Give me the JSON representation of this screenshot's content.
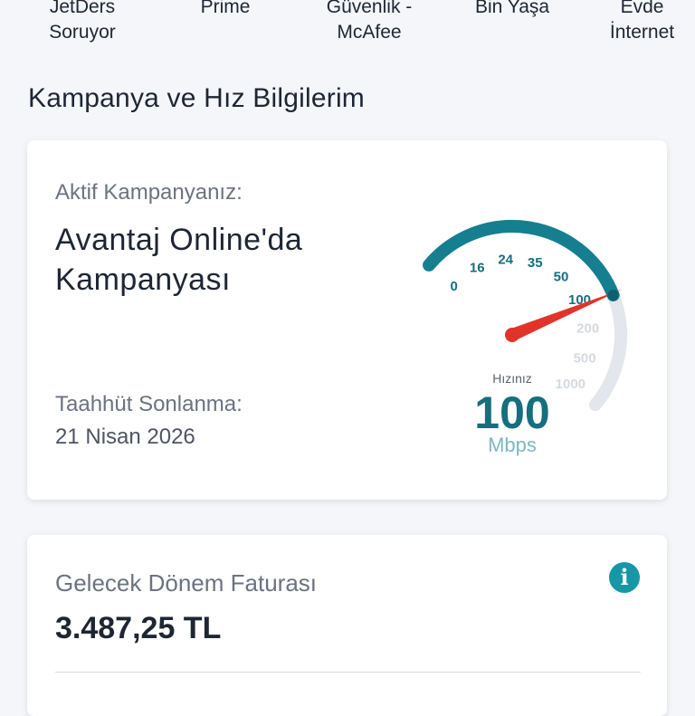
{
  "top_nav": {
    "items": [
      {
        "label_line1": "JetDers",
        "label_line2": "Soruyor"
      },
      {
        "label_line1": "Prime",
        "label_line2": ""
      },
      {
        "label_line1": "Güvenlik -",
        "label_line2": "McAfee"
      },
      {
        "label_line1": "Bin Yaşa",
        "label_line2": ""
      },
      {
        "label_line1": "Evde",
        "label_line2": "İnternet"
      }
    ]
  },
  "section": {
    "title": "Kampanya ve Hız Bilgilerim"
  },
  "campaign_card": {
    "active_label": "Aktif Kampanyanız:",
    "campaign_name": "Avantaj Online'da Kampanyası",
    "commitment_label": "Taahhüt Sonlanma:",
    "commitment_date": "21 Nisan 2026"
  },
  "speed_gauge": {
    "caption": "Hızınız",
    "value": "100",
    "unit": "Mbps",
    "ticks": [
      "0",
      "16",
      "24",
      "35",
      "50",
      "100",
      "200",
      "500",
      "1000"
    ],
    "active_ticks": 6,
    "colors": {
      "active": "#157f90",
      "inactive": "#e3e6ec",
      "needle": "#e2332b",
      "unit": "#7fb7c0"
    }
  },
  "bill_card": {
    "title": "Gelecek Dönem Faturası",
    "amount": "3.487,25 TL",
    "info_icon": "info-icon"
  }
}
